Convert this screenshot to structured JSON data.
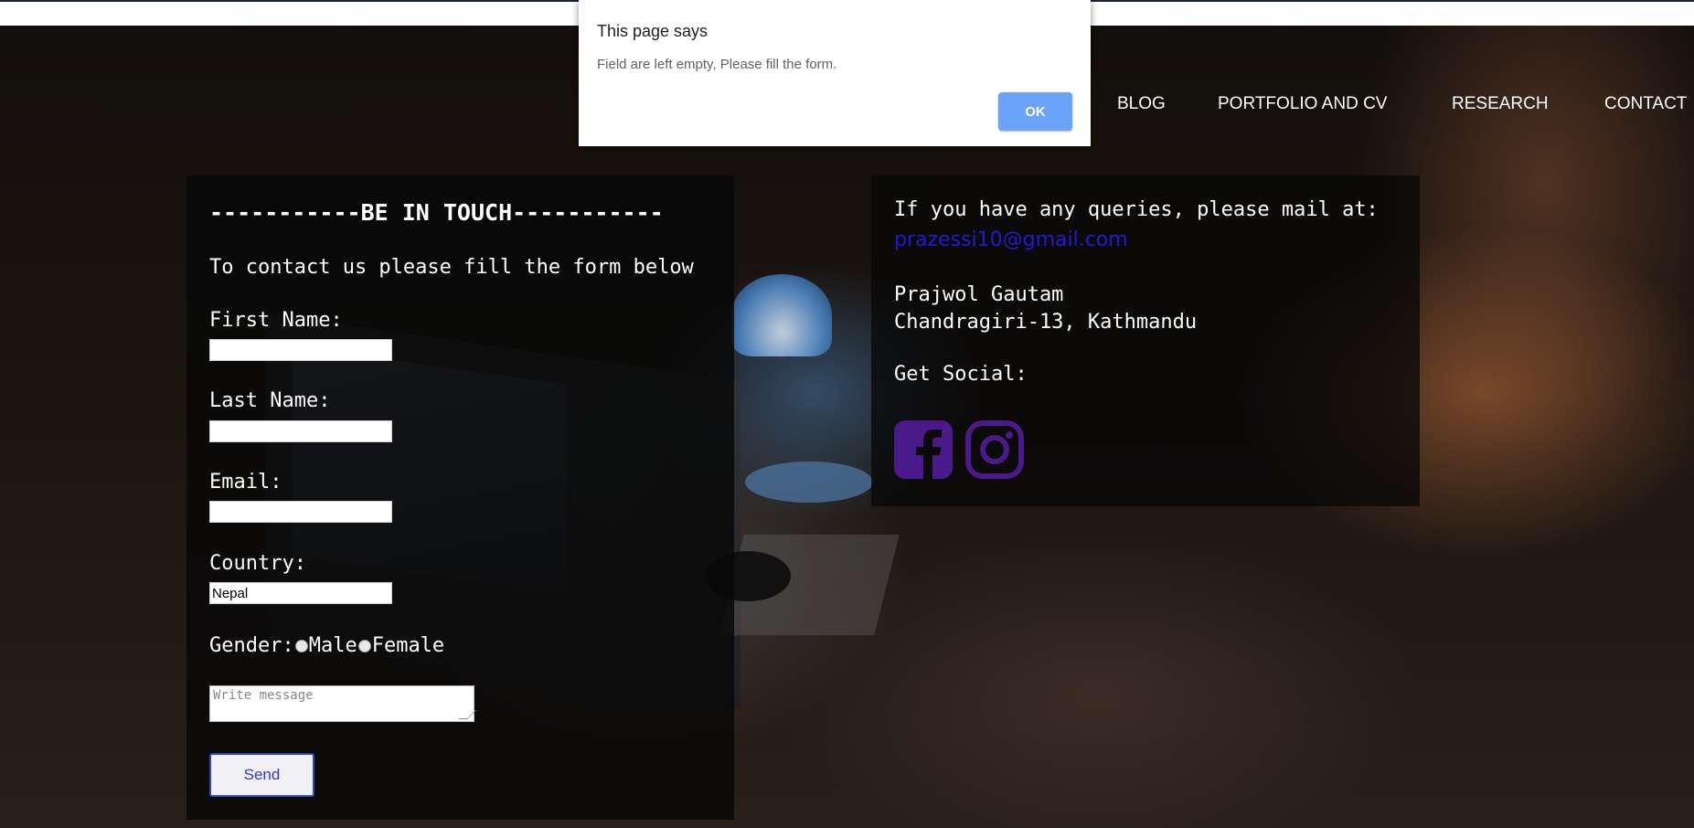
{
  "nav": {
    "items": [
      "BLOG",
      "PORTFOLIO AND CV",
      "RESEARCH",
      "CONTACT"
    ]
  },
  "form": {
    "heading": "-----------BE IN TOUCH-----------",
    "intro": "To contact us please fill the form below",
    "first_name_label": "First Name:",
    "first_name_value": "",
    "last_name_label": "Last Name:",
    "last_name_value": "",
    "email_label": "Email:",
    "email_value": "",
    "country_label": "Country:",
    "country_value": "Nepal",
    "gender_label": "Gender:",
    "gender_male": "Male",
    "gender_female": "Female",
    "message_placeholder": "Write message",
    "send_label": "Send"
  },
  "info": {
    "query_text": "If you have any queries, please mail at:",
    "email": "prazessi10@gmail.com",
    "name": "Prajwol Gautam",
    "address": "Chandragiri-13, Kathmandu",
    "social_label": "Get Social:",
    "social_icons": [
      "facebook-icon",
      "instagram-icon"
    ],
    "icon_color": "#4b1a8a",
    "link_color": "#2418d8"
  },
  "dialog": {
    "title": "This page says",
    "message": "Field are left empty, Please fill the form.",
    "ok_label": "OK",
    "button_color": "#6aa3f7"
  }
}
